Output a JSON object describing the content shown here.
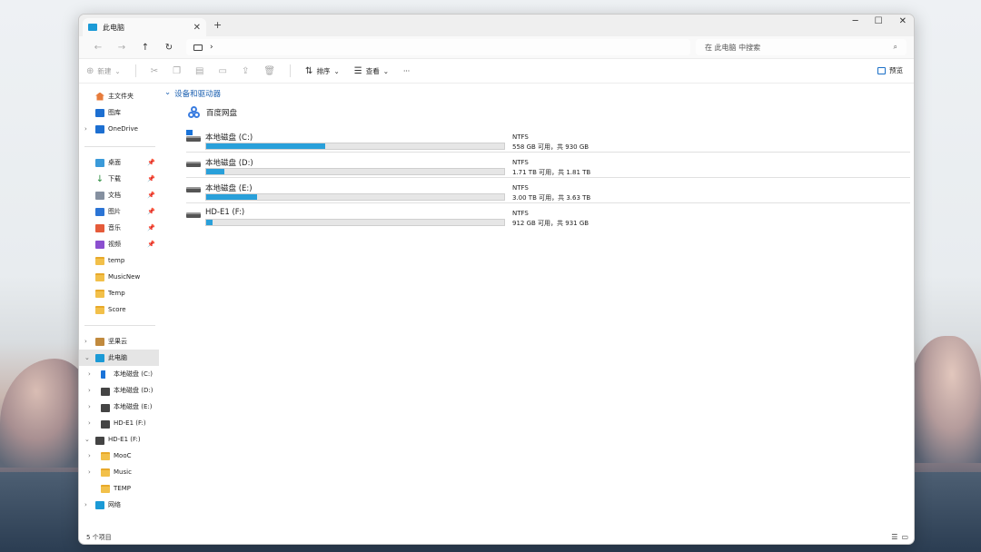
{
  "window": {
    "tab_title": "此电脑",
    "new_tab": "+",
    "controls": {
      "minimize": "─",
      "maximize": "☐",
      "close": "✕"
    }
  },
  "nav": {
    "back": "←",
    "forward": "→",
    "up": "↑",
    "refresh": "↻",
    "address_sep": "›",
    "search_placeholder": "在 此电脑 中搜索",
    "search_icon": "⌕"
  },
  "toolbar": {
    "new_label": "新建",
    "sort_label": "排序",
    "view_label": "查看",
    "more": "···",
    "preview_label": "预览"
  },
  "sidebar": {
    "quick": [
      {
        "label": "主文件夹",
        "icon": "home-icon"
      },
      {
        "label": "图库",
        "icon": "gallery-icon"
      },
      {
        "label": "OneDrive",
        "icon": "onedrive-icon"
      }
    ],
    "pinned": [
      {
        "label": "桌面",
        "icon": "desktop-icon"
      },
      {
        "label": "下载",
        "icon": "download-icon"
      },
      {
        "label": "文档",
        "icon": "documents-icon"
      },
      {
        "label": "图片",
        "icon": "pictures-icon"
      },
      {
        "label": "音乐",
        "icon": "music-icon"
      },
      {
        "label": "视频",
        "icon": "video-icon"
      },
      {
        "label": "temp",
        "icon": "folder-icon"
      },
      {
        "label": "MusicNew",
        "icon": "folder-icon"
      },
      {
        "label": "Temp",
        "icon": "folder-icon"
      },
      {
        "label": "Score",
        "icon": "folder-icon"
      }
    ],
    "tree": [
      {
        "label": "坚果云",
        "icon": "nutstore-icon"
      },
      {
        "label": "此电脑",
        "icon": "this-pc-icon"
      },
      {
        "label": "本地磁盘 (C:)",
        "icon": "windows-drive-icon"
      },
      {
        "label": "本地磁盘 (D:)",
        "icon": "drive-icon"
      },
      {
        "label": "本地磁盘 (E:)",
        "icon": "drive-icon"
      },
      {
        "label": "HD-E1 (F:)",
        "icon": "drive-icon"
      },
      {
        "label": "HD-E1 (F:)",
        "icon": "drive-icon"
      },
      {
        "label": "MooC",
        "icon": "folder-icon"
      },
      {
        "label": "Music",
        "icon": "folder-icon"
      },
      {
        "label": "TEMP",
        "icon": "folder-icon"
      },
      {
        "label": "网络",
        "icon": "network-icon"
      }
    ]
  },
  "main": {
    "group_title": "设备和驱动器",
    "baidu": "百度网盘",
    "drives": [
      {
        "name": "本地磁盘 (C:)",
        "fs": "NTFS",
        "free_text": "558 GB 可用，共 930 GB",
        "used_fraction": 0.4
      },
      {
        "name": "本地磁盘 (D:)",
        "fs": "NTFS",
        "free_text": "1.71 TB 可用，共 1.81 TB",
        "used_fraction": 0.06
      },
      {
        "name": "本地磁盘 (E:)",
        "fs": "NTFS",
        "free_text": "3.00 TB 可用，共 3.63 TB",
        "used_fraction": 0.17
      },
      {
        "name": "HD-E1 (F:)",
        "fs": "NTFS",
        "free_text": "912 GB 可用，共 931 GB",
        "used_fraction": 0.02
      }
    ]
  },
  "status": {
    "count": "5 个项目",
    "view_list": "☰",
    "view_tiles": "▭"
  }
}
